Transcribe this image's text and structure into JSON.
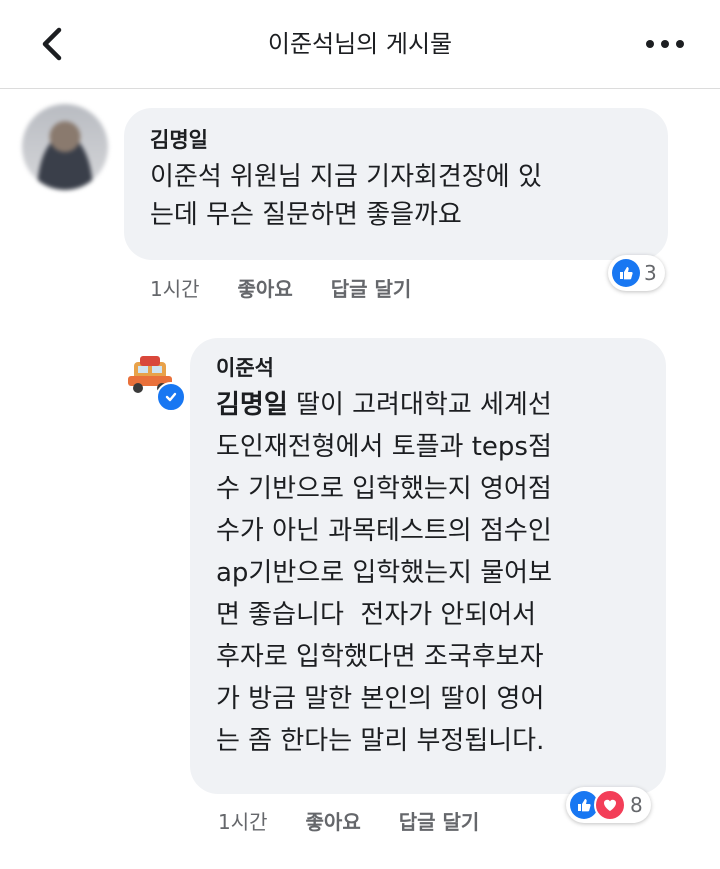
{
  "header": {
    "title": "이준석님의 게시물"
  },
  "comments": [
    {
      "author": "김명일",
      "text_lines": [
        "이준석 위원님 지금 기자회견장에 있",
        "는데 무슨 질문하면 좋을까요"
      ],
      "time": "1시간",
      "like_label": "좋아요",
      "reply_label": "답글 달기",
      "reaction_count": "3"
    },
    {
      "author": "이준석",
      "mention": "김명일",
      "first_line_rest": "딸이 고려대학교 세계선",
      "text_lines": [
        "도인재전형에서 토플과 teps점",
        "수 기반으로 입학했는지 영어점",
        "수가 아닌 과목테스트의 점수인",
        "ap기반으로 입학했는지 물어보",
        "면 좋습니다  전자가 안되어서",
        "후자로 입학했다면 조국후보자",
        "가 방금 말한 본인의 딸이 영어",
        "는 좀 한다는 말리 부정됩니다."
      ],
      "time": "1시간",
      "like_label": "좋아요",
      "reply_label": "답글 달기",
      "reaction_count": "8"
    }
  ],
  "icons": {
    "back": "chevron-left-icon",
    "more": "more-dots-icon",
    "like": "thumbs-up-icon",
    "love": "heart-icon",
    "verified": "verified-badge-icon"
  },
  "colors": {
    "like_blue": "#1877f2",
    "love_red": "#f33e58",
    "bubble_bg": "#f0f2f5",
    "meta_gray": "#65676b"
  }
}
